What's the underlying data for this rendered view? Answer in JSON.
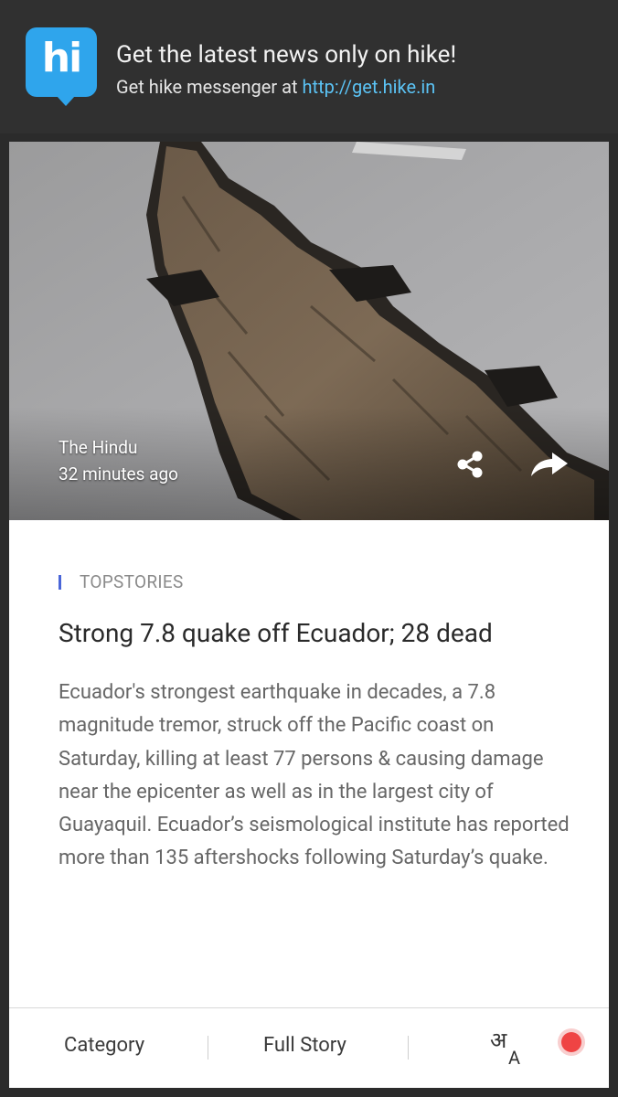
{
  "banner": {
    "logo_text": "hi",
    "title": "Get the latest news only on hike!",
    "subtitle_prefix": "Get hike messenger at ",
    "subtitle_link": "http://get.hike.in",
    "brand_color": "#2fa5ec",
    "link_color": "#5bc3f5"
  },
  "story": {
    "source": "The Hindu",
    "time_ago": "32 minutes ago",
    "category": "TOPSTORIES",
    "headline": "Strong 7.8 quake off Ecuador; 28 dead",
    "summary": "Ecuador's strongest earthquake in decades, a 7.8 magnitude tremor, struck off the Pacific coast on Saturday, killing at least 77 persons & causing damage near the epicenter as well as in the largest city of Guayaquil. Ecuador’s seismological institute has reported more than 135 aftershocks following Saturday’s quake.",
    "image_subject": "cracked road after earthquake",
    "icons": {
      "share": "share-icon",
      "forward": "forward-icon"
    },
    "category_color": "#4a66d8"
  },
  "bottom_bar": {
    "category_label": "Category",
    "full_story_label": "Full Story",
    "language_icon_hindi": "अ",
    "language_icon_latin": "A",
    "record_color": "#ef4444"
  }
}
